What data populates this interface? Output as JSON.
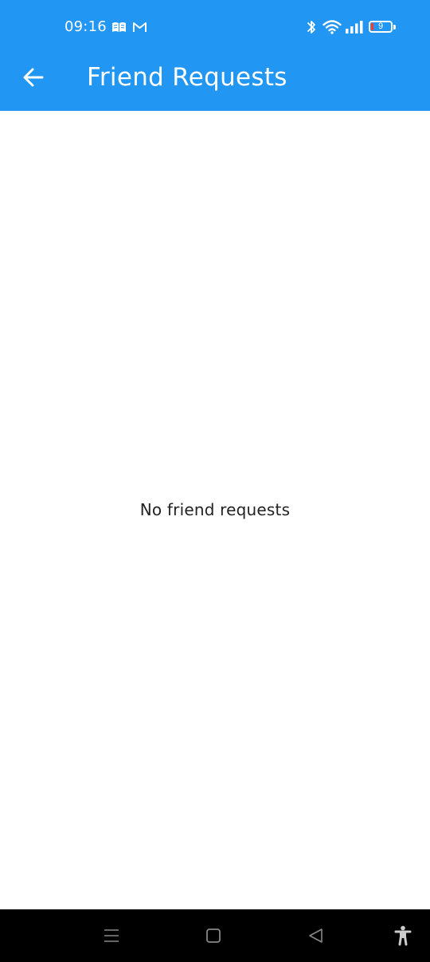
{
  "status_bar": {
    "time": "09:16",
    "battery_level": "9",
    "icons": [
      "book-icon",
      "gmail-icon",
      "bluetooth-icon",
      "wifi-icon",
      "signal-icon",
      "battery-icon"
    ]
  },
  "header": {
    "title": "Friend Requests",
    "back_icon": "arrow-left-icon",
    "background_color": "#2196f3"
  },
  "main": {
    "empty_message": "No friend requests"
  },
  "nav_bar": {
    "buttons": [
      "menu-icon",
      "home-icon",
      "back-icon",
      "accessibility-icon"
    ]
  }
}
